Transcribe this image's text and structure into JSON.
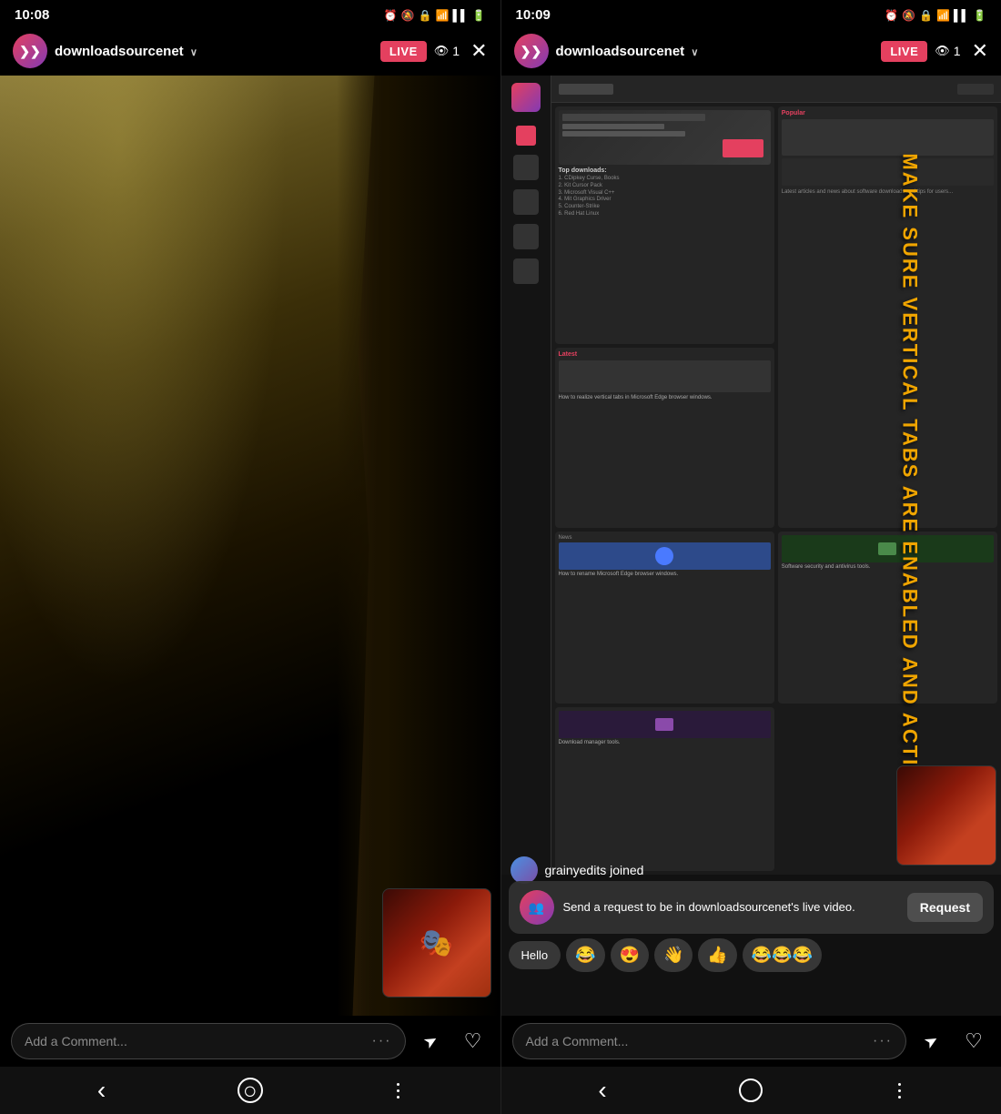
{
  "left_panel": {
    "status": {
      "time": "10:08",
      "icons": "🔔🔇🔒📶"
    },
    "header": {
      "username": "downloadsourcenet",
      "live_label": "LIVE",
      "viewer_count": "1",
      "close_label": "✕"
    },
    "comment_bar": {
      "placeholder": "Add a Comment...",
      "dots": "···"
    },
    "send_icon": "➤",
    "heart_icon": "♡"
  },
  "right_panel": {
    "status": {
      "time": "10:09",
      "icons": "🔔🔇🔒📶"
    },
    "header": {
      "username": "downloadsourcenet",
      "live_label": "LIVE",
      "viewer_count": "1",
      "close_label": "✕"
    },
    "website_overlay_text": "MAKE SURE VERTICAL TABS ARE ENABLED AND ACTIVE",
    "joined_notification": "grainyedits joined",
    "request_banner": {
      "text": "Send a request to be in downloadsourcenet's live video.",
      "button_label": "Request"
    },
    "emoji_bar": {
      "items": [
        "Hello",
        "😂",
        "😍",
        "👋",
        "👍",
        "😂😂😂"
      ]
    },
    "comment_bar": {
      "placeholder": "Add a Comment...",
      "dots": "···"
    },
    "send_icon": "➤",
    "heart_icon": "♡"
  },
  "nav": {
    "back": "‹",
    "home": "○",
    "menu": "⫶"
  }
}
